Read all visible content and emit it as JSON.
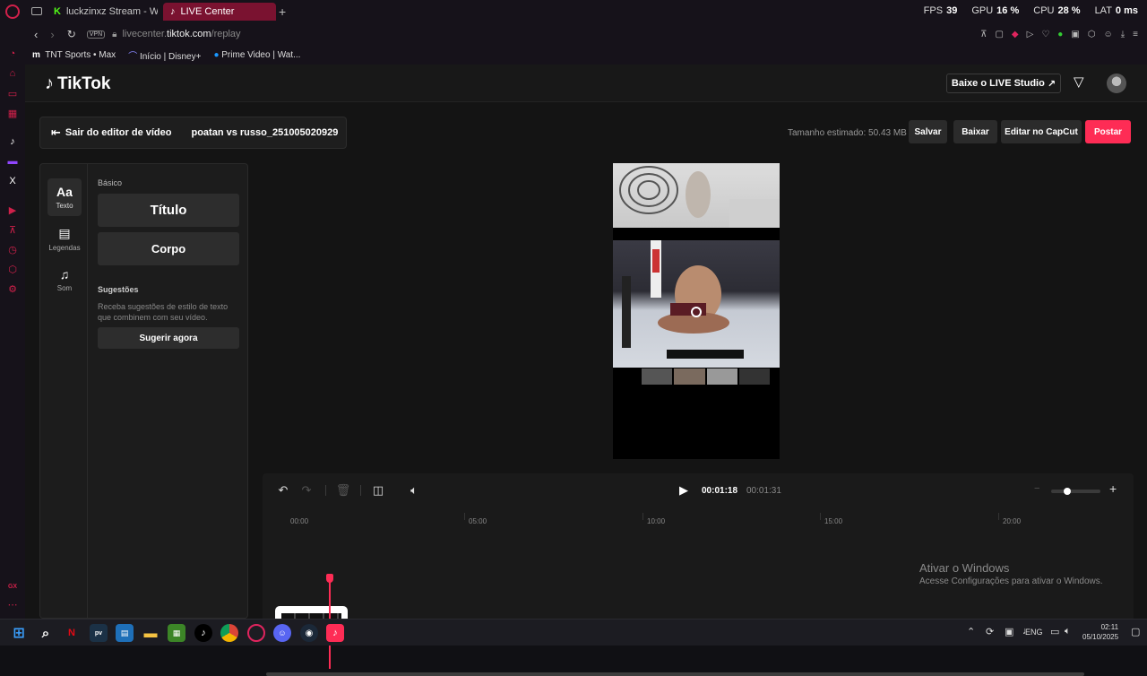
{
  "browser": {
    "tabs": [
      {
        "label": "luckzinxz Stream - Watch"
      },
      {
        "label": "LIVE Center"
      }
    ],
    "url_prefix": "livecenter.",
    "url_domain": "tiktok.com",
    "url_path": "/replay",
    "vpn_label": "VPN",
    "stats": {
      "fps_label": "FPS",
      "fps": "39",
      "gpu_label": "GPU",
      "gpu": "16 %",
      "cpu_label": "CPU",
      "cpu": "28 %",
      "lat_label": "LAT",
      "lat": "0 ms"
    },
    "bookmarks": [
      "TNT Sports • Max",
      "Início | Disney+",
      "Prime Video | Wat..."
    ]
  },
  "app": {
    "logo_text": "TikTok",
    "download_studio": "Baixe o LIVE Studio",
    "exit_editor": "Sair do editor de vídeo",
    "video_name": "poatan vs russo_251005020929",
    "estimated_size": "Tamanho estimado: 50.43 MB",
    "buttons": {
      "save": "Salvar",
      "download": "Baixar",
      "capcut": "Editar no CapCut",
      "post": "Postar"
    },
    "tools": [
      {
        "glyph": "Aa",
        "label": "Texto"
      },
      {
        "glyph": "▤",
        "label": "Legendas"
      },
      {
        "glyph": "♫",
        "label": "Som"
      }
    ],
    "basic_label": "Básico",
    "title_card": "Título",
    "body_card": "Corpo",
    "suggestions_label": "Sugestões",
    "suggestions_desc": "Receba sugestões de estilo de texto que combinem com seu vídeo.",
    "suggest_button": "Sugerir agora"
  },
  "timeline": {
    "current_time": "00:01:18",
    "total_time": "00:01:31",
    "ruler": [
      "00:00",
      "05:00",
      "10:00",
      "15:00",
      "20:00"
    ],
    "zoom_level": 0.3
  },
  "watermark": {
    "title": "Ativar o Windows",
    "subtitle": "Acesse Configurações para ativar o Windows."
  },
  "taskbar": {
    "lang": "ENG",
    "time": "02:11",
    "date": "05/10/2025"
  },
  "colors": {
    "accent": "#fe2c55",
    "browser_accent": "#d0204a"
  }
}
